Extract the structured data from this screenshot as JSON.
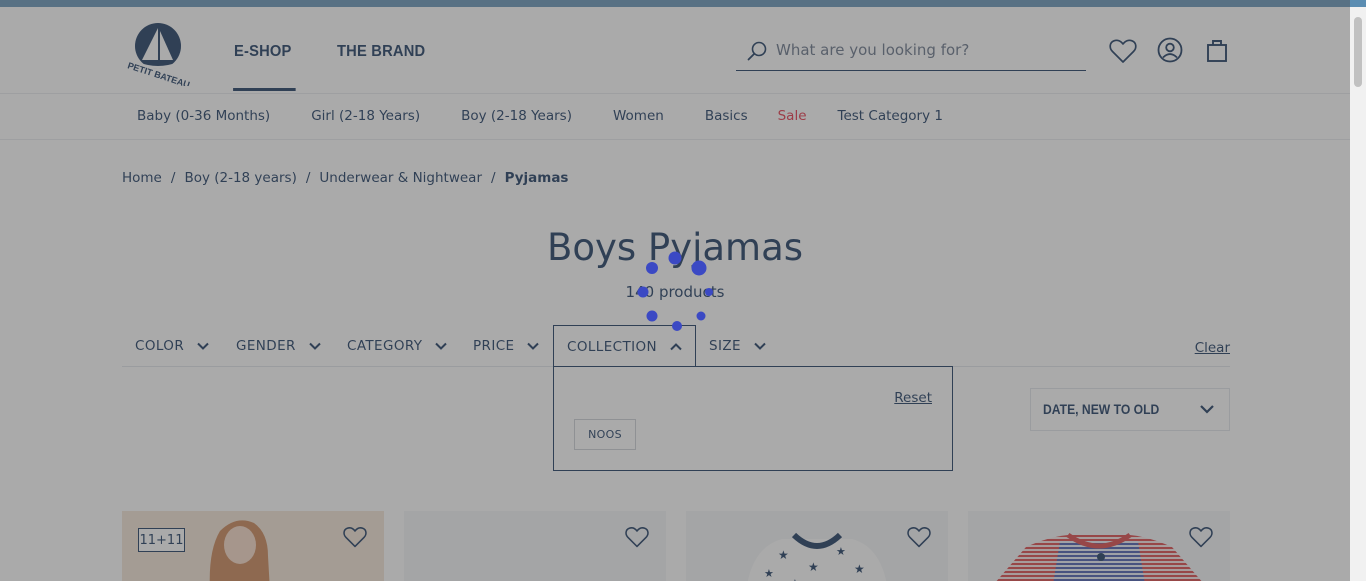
{
  "header": {
    "logo_text": "PETIT BATEAU",
    "nav": [
      {
        "label": "E-SHOP",
        "active": true
      },
      {
        "label": "THE BRAND",
        "active": false
      }
    ],
    "search_placeholder": "What are you looking for?",
    "icons": [
      "search-icon",
      "heart-icon",
      "account-icon",
      "bag-icon"
    ]
  },
  "categories": [
    "Baby (0-36 Months)",
    "Girl (2-18 Years)",
    "Boy (2-18 Years)",
    "Women",
    "Basics",
    "Sale",
    "Test Category 1"
  ],
  "breadcrumb": [
    "Home",
    "Boy (2-18 years)",
    "Underwear & Nightwear",
    "Pyjamas"
  ],
  "page": {
    "title": "Boys Pyjamas",
    "count": "140 products"
  },
  "filters": [
    {
      "label": "COLOR",
      "open": false
    },
    {
      "label": "GENDER",
      "open": false
    },
    {
      "label": "CATEGORY",
      "open": false
    },
    {
      "label": "PRICE",
      "open": false
    },
    {
      "label": "COLLECTION",
      "open": true
    },
    {
      "label": "SIZE",
      "open": false
    }
  ],
  "clear_label": "Clear",
  "dropdown": {
    "reset_label": "Reset",
    "options": [
      "NOOS"
    ]
  },
  "sort": {
    "selected": "DATE, NEW TO OLD"
  },
  "products": [
    {
      "badge": "11+11"
    },
    {
      "badge": ""
    },
    {
      "badge": ""
    },
    {
      "badge": ""
    }
  ],
  "colors": {
    "navy": "#0a2a55",
    "sale_red": "#e2243a",
    "spinner": "#3b49c4",
    "overlay": "rgba(85,85,85,0.5)"
  }
}
